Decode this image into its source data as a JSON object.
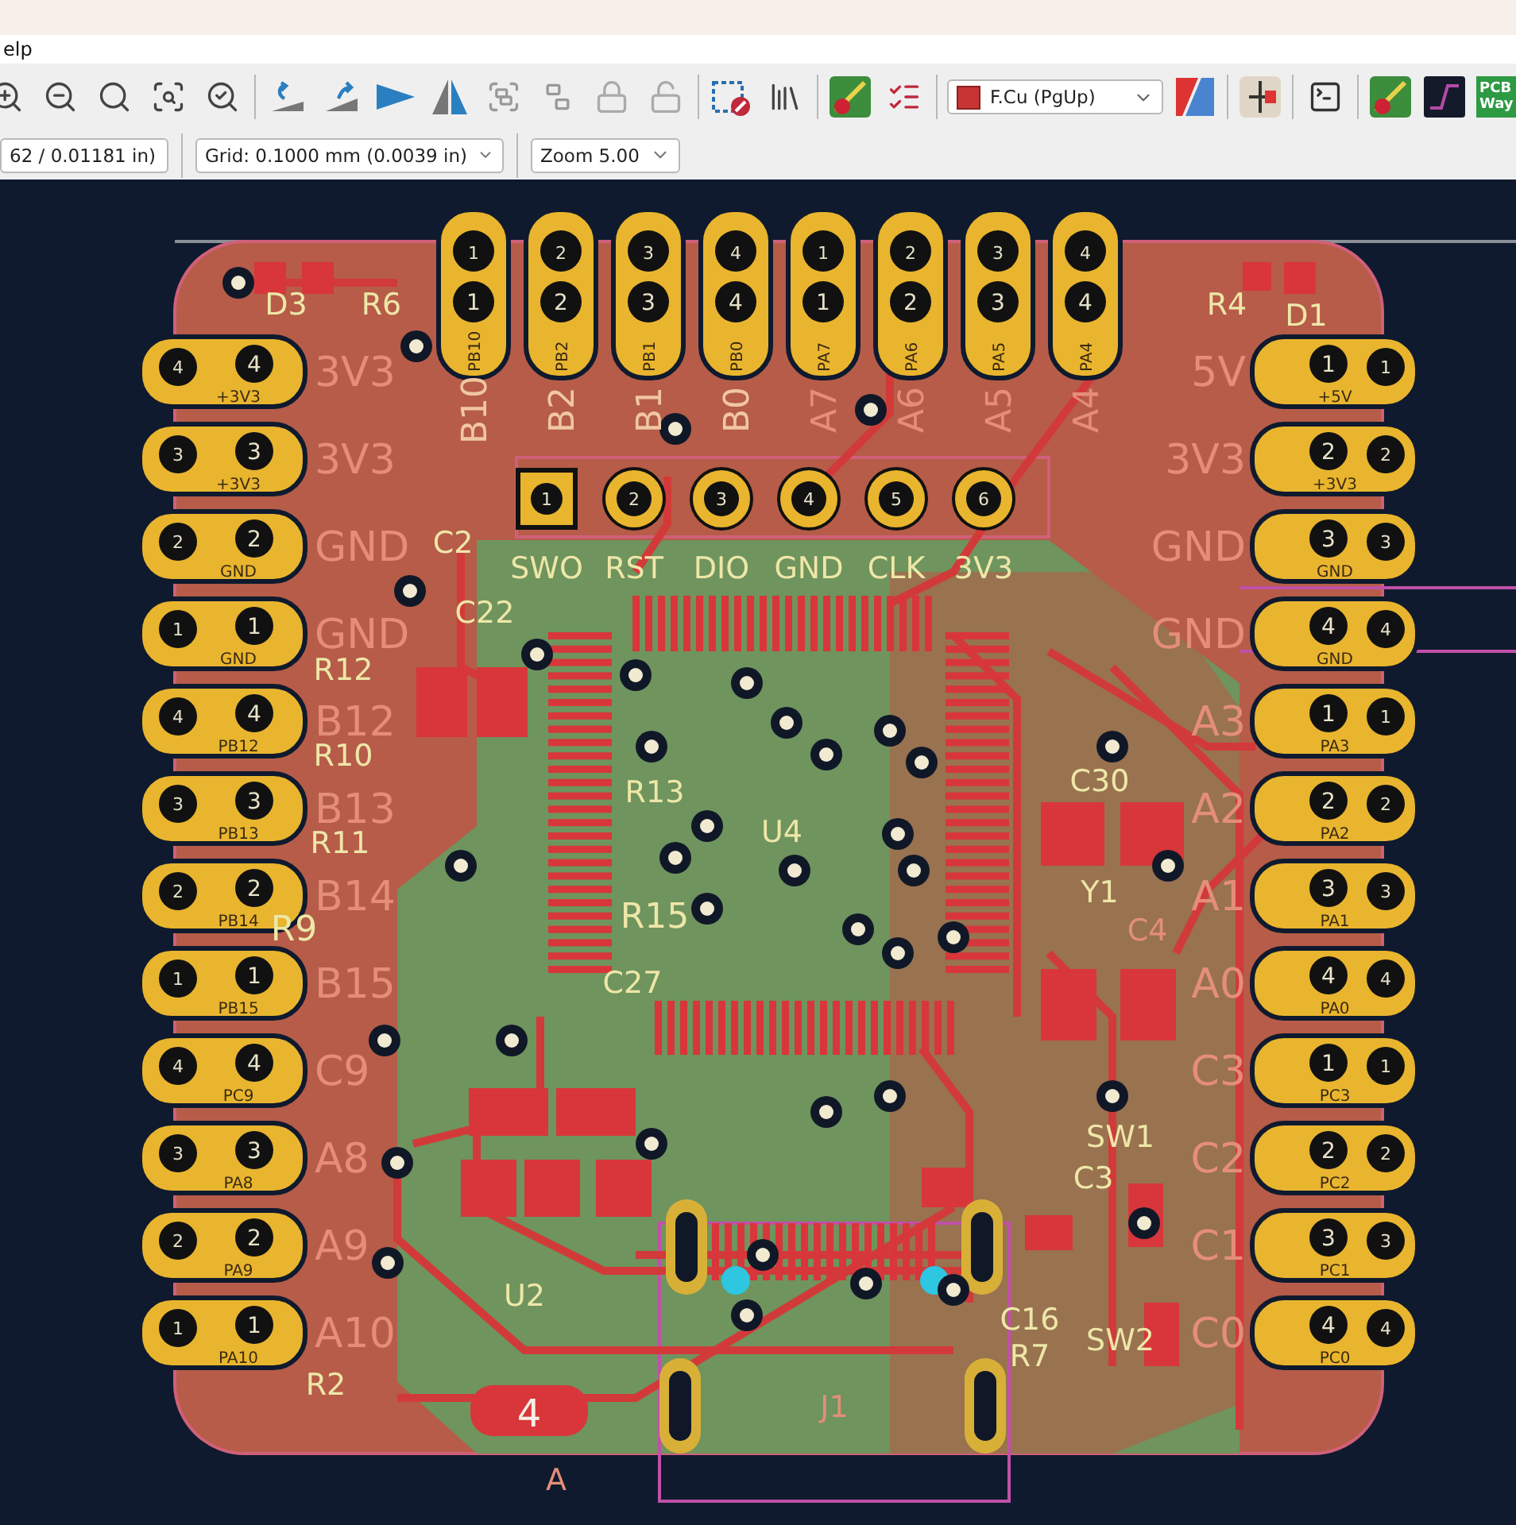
{
  "menu_bar": {
    "items": [
      "elp"
    ]
  },
  "toolbar": {
    "layer_select": {
      "value": "F.Cu (PgUp)"
    },
    "badge_lines": [
      "PCB",
      "Way"
    ]
  },
  "options_bar": {
    "fields": [
      {
        "value": "62 / 0.01181 in)"
      },
      {
        "value": "Grid: 0.1000 mm (0.0039 in)"
      },
      {
        "value": "Zoom 5.00"
      }
    ]
  },
  "pcb": {
    "top_header": [
      {
        "hole_labels": [
          "1",
          "1"
        ],
        "net": "PB10",
        "silk": "B10"
      },
      {
        "hole_labels": [
          "2",
          "2"
        ],
        "net": "PB2",
        "silk": "B2"
      },
      {
        "hole_labels": [
          "3",
          "3"
        ],
        "net": "PB1",
        "silk": "B1"
      },
      {
        "hole_labels": [
          "4",
          "4"
        ],
        "net": "PB0",
        "silk": "B0"
      },
      {
        "hole_labels": [
          "1",
          "1"
        ],
        "net": "PA7",
        "silk": "A7"
      },
      {
        "hole_labels": [
          "2",
          "2"
        ],
        "net": "PA6",
        "silk": "A6"
      },
      {
        "hole_labels": [
          "3",
          "3"
        ],
        "net": "PA5",
        "silk": "A5"
      },
      {
        "hole_labels": [
          "4",
          "4"
        ],
        "net": "PA4",
        "silk": "A4"
      }
    ],
    "left_header": [
      {
        "hole_labels": [
          "4",
          "4"
        ],
        "net": "+3V3",
        "silk": "3V3"
      },
      {
        "hole_labels": [
          "3",
          "3"
        ],
        "net": "+3V3",
        "silk": "3V3"
      },
      {
        "hole_labels": [
          "2",
          "2"
        ],
        "net": "GND",
        "silk": "GND"
      },
      {
        "hole_labels": [
          "1",
          "1"
        ],
        "net": "GND",
        "silk": "GND"
      },
      {
        "hole_labels": [
          "4",
          "4"
        ],
        "net": "PB12",
        "silk": "B12"
      },
      {
        "hole_labels": [
          "3",
          "3"
        ],
        "net": "PB13",
        "silk": "B13"
      },
      {
        "hole_labels": [
          "2",
          "2"
        ],
        "net": "PB14",
        "silk": "B14"
      },
      {
        "hole_labels": [
          "1",
          "1"
        ],
        "net": "PB15",
        "silk": "B15"
      },
      {
        "hole_labels": [
          "4",
          "4"
        ],
        "net": "PC9",
        "silk": "C9"
      },
      {
        "hole_labels": [
          "3",
          "3"
        ],
        "net": "PA8",
        "silk": "A8"
      },
      {
        "hole_labels": [
          "2",
          "2"
        ],
        "net": "PA9",
        "silk": "A9"
      },
      {
        "hole_labels": [
          "1",
          "1"
        ],
        "net": "PA10",
        "silk": "A10"
      }
    ],
    "right_header": [
      {
        "hole_labels": [
          "1",
          "1"
        ],
        "net": "+5V",
        "silk": "5V"
      },
      {
        "hole_labels": [
          "2",
          "2"
        ],
        "net": "+3V3",
        "silk": "3V3"
      },
      {
        "hole_labels": [
          "3",
          "3"
        ],
        "net": "GND",
        "silk": "GND"
      },
      {
        "hole_labels": [
          "4",
          "4"
        ],
        "net": "GND",
        "silk": "GND"
      },
      {
        "hole_labels": [
          "1",
          "1"
        ],
        "net": "PA3",
        "silk": "A3"
      },
      {
        "hole_labels": [
          "2",
          "2"
        ],
        "net": "PA2",
        "silk": "A2"
      },
      {
        "hole_labels": [
          "3",
          "3"
        ],
        "net": "PA1",
        "silk": "A1"
      },
      {
        "hole_labels": [
          "4",
          "4"
        ],
        "net": "PA0",
        "silk": "A0"
      },
      {
        "hole_labels": [
          "1",
          "1"
        ],
        "net": "PC3",
        "silk": "C3"
      },
      {
        "hole_labels": [
          "2",
          "2"
        ],
        "net": "PC2",
        "silk": "C2"
      },
      {
        "hole_labels": [
          "3",
          "3"
        ],
        "net": "PC1",
        "silk": "C1"
      },
      {
        "hole_labels": [
          "4",
          "4"
        ],
        "net": "PC0",
        "silk": "C0"
      }
    ],
    "swd_header": [
      {
        "hole_label": "1",
        "silk": "SWO"
      },
      {
        "hole_label": "2",
        "silk": "RST"
      },
      {
        "hole_label": "3",
        "silk": "DIO"
      },
      {
        "hole_label": "4",
        "silk": "GND"
      },
      {
        "hole_label": "5",
        "silk": "CLK"
      },
      {
        "hole_label": "6",
        "silk": "3V3"
      }
    ],
    "references": [
      "D3",
      "R6",
      "R4",
      "D1",
      "C2",
      "C22",
      "R12",
      "R10",
      "C30",
      "R13",
      "R11",
      "U4",
      "R9",
      "Y1",
      "R15",
      "C4",
      "C27",
      "SW1",
      "C3",
      "U2",
      "C16",
      "SW2",
      "R7",
      "R2",
      "J1",
      "A"
    ],
    "pad_label": "4"
  }
}
